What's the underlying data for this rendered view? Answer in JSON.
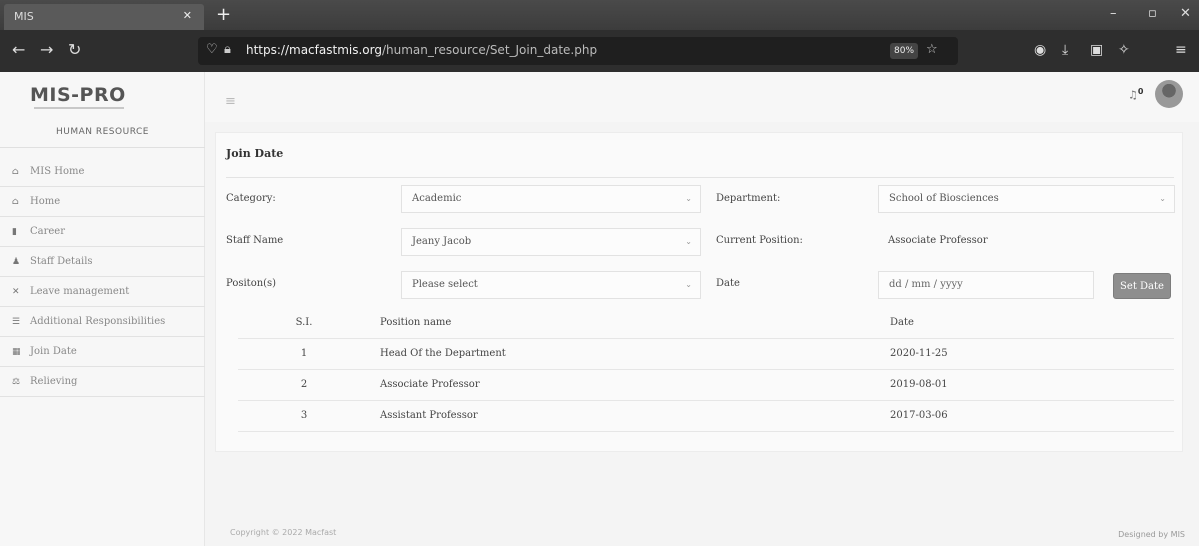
{
  "browser": {
    "tab_title": "MIS",
    "url_host": "https://macfastmis.org",
    "url_path": "/human_resource/Set_Join_date.php",
    "zoom": "80%"
  },
  "sidebar": {
    "logo": "MIS-PRO",
    "module": "HUMAN RESOURCE",
    "items": [
      {
        "icon": "home-icon",
        "label": "MIS Home"
      },
      {
        "icon": "home-icon",
        "label": "Home"
      },
      {
        "icon": "career-icon",
        "label": "Career"
      },
      {
        "icon": "user-icon",
        "label": "Staff Details"
      },
      {
        "icon": "cross-icon",
        "label": "Leave management"
      },
      {
        "icon": "list-icon",
        "label": "Additional Responsibilities"
      },
      {
        "icon": "calendar-icon",
        "label": "Join Date"
      },
      {
        "icon": "scale-icon",
        "label": "Relieving"
      }
    ]
  },
  "header": {
    "notification_count": "0"
  },
  "form": {
    "title": "Join Date",
    "category_label": "Category:",
    "category_value": "Academic",
    "department_label": "Department:",
    "department_value": "School of Biosciences",
    "staff_label": "Staff Name",
    "staff_value": "Jeany Jacob",
    "current_position_label": "Current Position:",
    "current_position_value": "Associate Professor",
    "position_label": "Positon(s)",
    "position_value": "Please select",
    "date_label": "Date",
    "date_placeholder": "dd / mm / yyyy",
    "set_date_button": "Set Date"
  },
  "table": {
    "headers": [
      "S.I.",
      "Position name",
      "Date"
    ],
    "rows": [
      [
        "1",
        "Head Of the Department",
        "2020-11-25"
      ],
      [
        "2",
        "Associate Professor",
        "2019-08-01"
      ],
      [
        "3",
        "Assistant Professor",
        "2017-03-06"
      ]
    ]
  },
  "footer": {
    "copyright": "Copyright © 2022 Macfast",
    "designed_by": "Designed by MIS"
  }
}
